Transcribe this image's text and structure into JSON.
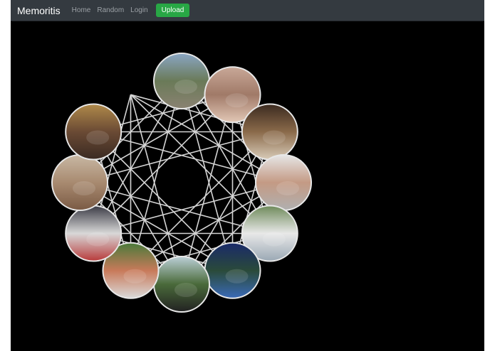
{
  "navbar": {
    "brand": "Memoritis",
    "links": [
      "Home",
      "Random",
      "Login"
    ],
    "upload_label": "Upload"
  },
  "colors": {
    "navbar_bg": "#343a40",
    "page_bg": "#000000",
    "upload_btn": "#28a745",
    "link_color": "#9ba0a5",
    "line_color": "#d4d4d4"
  },
  "graph": {
    "node_count": 12,
    "photos": [
      {
        "name": "railroad-tracks-photo",
        "bg": [
          "#8aa6c4",
          "#6a7a58",
          "#8a8272"
        ]
      },
      {
        "name": "curtain-photo",
        "bg": [
          "#c9a898",
          "#a07a68",
          "#e2c7b6"
        ]
      },
      {
        "name": "station-hall-photo",
        "bg": [
          "#3b2a20",
          "#8a6a4a",
          "#d8cbb8"
        ]
      },
      {
        "name": "finger-touch-photo",
        "bg": [
          "#e6e6e6",
          "#c49a84",
          "#b0b0b0"
        ]
      },
      {
        "name": "white-car-photo",
        "bg": [
          "#6e8a5a",
          "#e8e8e8",
          "#9aa8b4"
        ]
      },
      {
        "name": "pool-hall-photo",
        "bg": [
          "#1a2a6a",
          "#2a4a3a",
          "#3a6ab8"
        ]
      },
      {
        "name": "road-windshield-photo",
        "bg": [
          "#bcd0d8",
          "#4a6a3a",
          "#222222"
        ]
      },
      {
        "name": "street-crowd-photo",
        "bg": [
          "#4a7a3a",
          "#c87a5a",
          "#dadada"
        ]
      },
      {
        "name": "american-flag-photo",
        "bg": [
          "#3a3a44",
          "#d8d8d8",
          "#b83a3a"
        ]
      },
      {
        "name": "desert-rock-photo",
        "bg": [
          "#c8b8a4",
          "#a88a70",
          "#7a5a44"
        ]
      },
      {
        "name": "sunset-sky-photo",
        "bg": [
          "#b08a4a",
          "#6a4a34",
          "#3a2a22"
        ]
      }
    ]
  }
}
